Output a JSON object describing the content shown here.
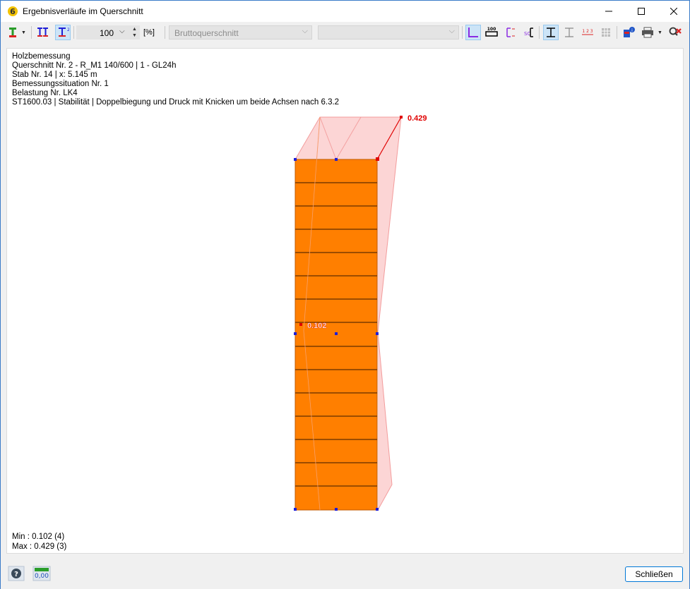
{
  "window": {
    "title": "Ergebnisverläufe im Querschnitt"
  },
  "toolbar": {
    "zoom_value": "100",
    "zoom_unit": "[%]",
    "section_type_combo": "Bruttoquerschnitt",
    "empty_combo": "",
    "scale_icon_label": "100",
    "numbering_icon_label": "1 2 3"
  },
  "info": {
    "line1": "Holzbemessung",
    "line2": "Querschnitt Nr. 2 - R_M1 140/600 | 1 - GL24h",
    "line3": "Stab Nr. 14 | x: 5.145 m",
    "line4": "Bemessungssituation Nr. 1",
    "line5": "Belastung Nr. LK4",
    "line6": "ST1600.03 | Stabilität | Doppelbiegung und Druck mit Knicken um beide Achsen nach 6.3.2"
  },
  "results": {
    "max_label": "0.429",
    "min_label": "0.102",
    "min_text": "Min : 0.102  (4)",
    "max_text": "Max : 0.429  (3)"
  },
  "footer": {
    "close_label": "Schließen",
    "decimal_icon_label": "0,00"
  },
  "colors": {
    "section_fill": "#ff7f00",
    "diagram_fill": "#f9b2b2",
    "extreme_marker": "#e00000",
    "node_marker": "#1f1fd6",
    "accent": "#0078d7"
  }
}
